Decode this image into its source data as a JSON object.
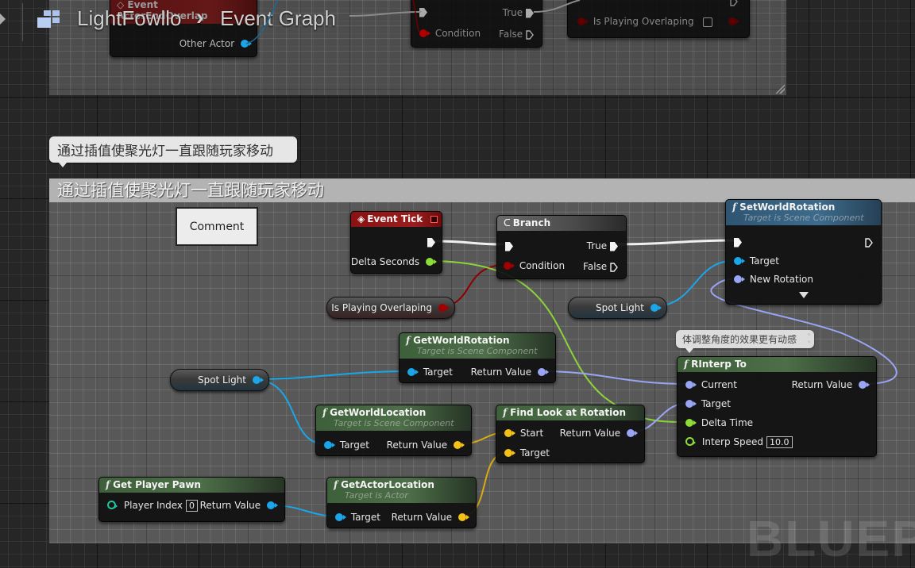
{
  "breadcrumb": {
    "blueprint_name": "LightFowllo",
    "separator": "›",
    "graph_name": "Event Graph",
    "icon": "blueprint-grid-icon"
  },
  "top_comment": {
    "nodes": {
      "event_actor_end_overlap": {
        "title": "Event ActorEndOverlap",
        "pins": {
          "other_actor": "Other Actor"
        }
      },
      "branch": {
        "pins": {
          "true": "True",
          "condition": "Condition",
          "false": "False"
        }
      },
      "set_var": {
        "pins": {
          "is_playing_overlaping": "Is Playing Overlaping"
        }
      }
    }
  },
  "bubble_comment": "通过插值使聚光灯一直跟随玩家移动",
  "main_comment": {
    "title": "通过插值使聚光灯一直跟随玩家移动",
    "comment_button": "Comment"
  },
  "nodes": {
    "event_tick": {
      "title": "Event Tick",
      "pins": {
        "delta_seconds": "Delta Seconds"
      }
    },
    "branch": {
      "title": "Branch",
      "pins": {
        "condition": "Condition",
        "true": "True",
        "false": "False"
      }
    },
    "set_world_rotation": {
      "title": "SetWorldRotation",
      "subtitle": "Target is Scene Component",
      "pins": {
        "target": "Target",
        "new_rotation": "New Rotation"
      }
    },
    "get_world_rotation": {
      "title": "GetWorldRotation",
      "subtitle": "Target is Scene Component",
      "pins": {
        "target": "Target",
        "return_value": "Return Value"
      }
    },
    "get_world_location": {
      "title": "GetWorldLocation",
      "subtitle": "Target is Scene Component",
      "pins": {
        "target": "Target",
        "return_value": "Return Value"
      }
    },
    "find_look_at_rotation": {
      "title": "Find Look at Rotation",
      "pins": {
        "start": "Start",
        "target": "Target",
        "return_value": "Return Value"
      }
    },
    "rinterp_to": {
      "title": "RInterp To",
      "comment": "体调整角度的效果更有动感",
      "pins": {
        "current": "Current",
        "target": "Target",
        "delta_time": "Delta Time",
        "interp_speed": "Interp Speed",
        "return_value": "Return Value"
      },
      "interp_speed_value": "10.0"
    },
    "get_player_pawn": {
      "title": "Get Player Pawn",
      "pins": {
        "player_index": "Player Index",
        "return_value": "Return Value"
      },
      "player_index_value": "0"
    },
    "get_actor_location": {
      "title": "GetActorLocation",
      "subtitle": "Target is Actor",
      "pins": {
        "target": "Target",
        "return_value": "Return Value"
      }
    }
  },
  "variables": {
    "is_playing_overlaping": "Is Playing Overlaping",
    "spot_light_1": "Spot Light",
    "spot_light_2": "Spot Light"
  },
  "watermark": "BLUEPRINT",
  "colors": {
    "exec": "#f4f4f4",
    "bool": "#8c0000",
    "float": "#7fd62f",
    "object": "#1aa6e8",
    "rotator": "#9aa5f5",
    "vector": "#f5c118",
    "int": "#1fc7a0",
    "function_header": "#4d6e48",
    "event_header": "#9b1d1d",
    "target_function_header": "#3e6b8c"
  }
}
